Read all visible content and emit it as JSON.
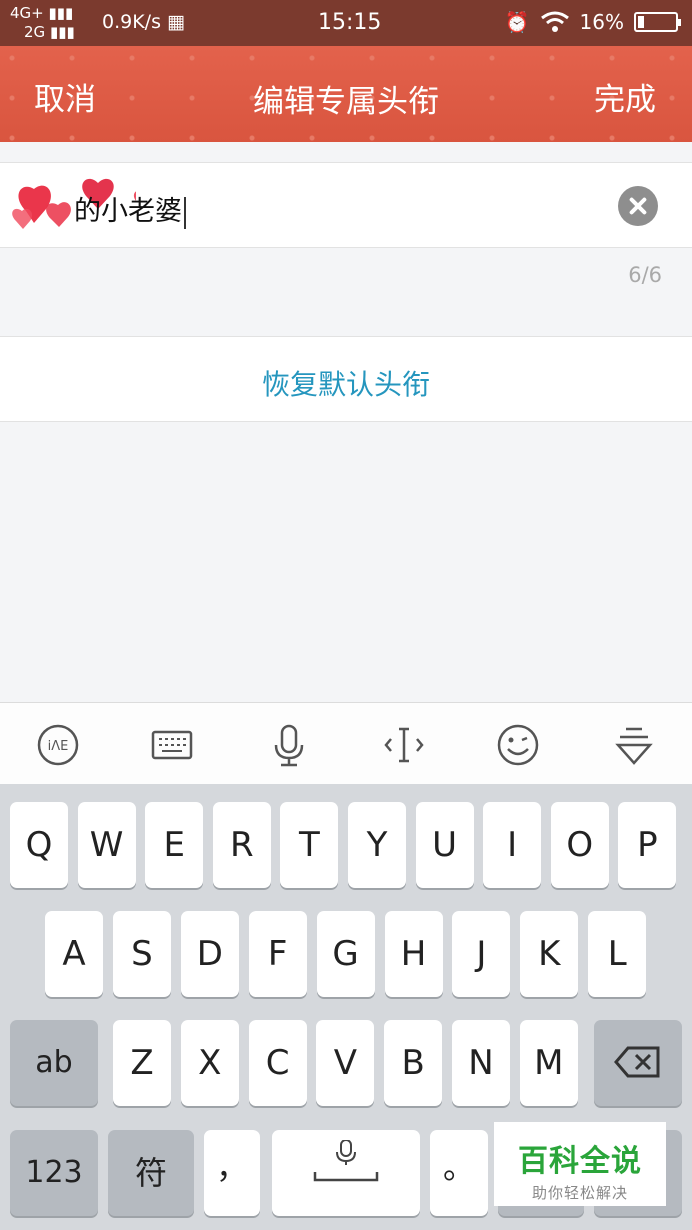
{
  "status_bar": {
    "network_top": "4G+",
    "network_bottom": "2G",
    "speed": "0.9K/s",
    "time": "15:15",
    "battery": "16%",
    "battery_level": 0.16,
    "icons": [
      "signal-icon",
      "keyboard-icon",
      "alarm-icon",
      "wifi-icon",
      "battery-icon"
    ]
  },
  "nav": {
    "cancel": "取消",
    "title": "编辑专属头衔",
    "done": "完成"
  },
  "input": {
    "value": "的小老婆",
    "counter": "6/6"
  },
  "restore": {
    "label": "恢复默认头衔"
  },
  "toolbar": {
    "icons": [
      "handwriting-icon",
      "keyboard-switch-icon",
      "microphone-icon",
      "cursor-move-icon",
      "emoji-icon",
      "hide-keyboard-icon"
    ],
    "handwriting_label": "iΛE"
  },
  "keyboard": {
    "row1": [
      "Q",
      "W",
      "E",
      "R",
      "T",
      "Y",
      "U",
      "I",
      "O",
      "P"
    ],
    "row2": [
      "A",
      "S",
      "D",
      "F",
      "G",
      "H",
      "J",
      "K",
      "L"
    ],
    "row3": [
      "Z",
      "X",
      "C",
      "V",
      "B",
      "N",
      "M"
    ],
    "shift_label": "ab",
    "numbers_label": "123",
    "symbols_label": "符",
    "comma_label": "，",
    "period_label": "。"
  },
  "watermark": {
    "main": "百科全说",
    "sub": "助你轻松解决"
  },
  "colors": {
    "nav_background": "#d9553f",
    "accent_link": "#2596be",
    "watermark_green": "#2aa53a"
  }
}
